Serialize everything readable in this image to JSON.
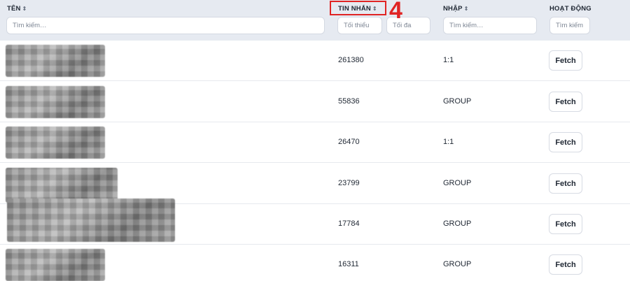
{
  "columns": {
    "name": {
      "title": "TÊN",
      "sort_icon": "⇕"
    },
    "messages": {
      "title": "TIN NHẮN",
      "sort_icon": "⇕"
    },
    "type": {
      "title": "NHẬP",
      "sort_icon": "⇕"
    },
    "actions": {
      "title": "HOẠT ĐỘNG"
    }
  },
  "filters": {
    "name_placeholder": "Tìm kiếm…",
    "min_placeholder": "Tối thiểu",
    "max_placeholder": "Tối đa",
    "type_placeholder": "Tìm kiếm…",
    "actions_placeholder": "Tìm kiếm…"
  },
  "annotation": {
    "marker": "4",
    "color": "#e02424"
  },
  "rows": [
    {
      "messages": "261380",
      "type": "1:1",
      "action": "Fetch"
    },
    {
      "messages": "55836",
      "type": "GROUP",
      "action": "Fetch"
    },
    {
      "messages": "26470",
      "type": "1:1",
      "action": "Fetch"
    },
    {
      "messages": "23799",
      "type": "GROUP",
      "action": "Fetch"
    },
    {
      "messages": "17784",
      "type": "GROUP",
      "action": "Fetch"
    },
    {
      "messages": "16311",
      "type": "GROUP",
      "action": "Fetch"
    }
  ]
}
